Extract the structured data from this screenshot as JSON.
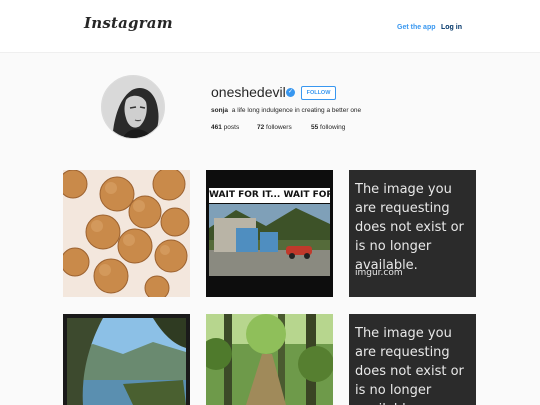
{
  "header": {
    "logo_text": "Instagram",
    "get_app_label": "Get the app",
    "login_label": "Log in"
  },
  "profile": {
    "username": "oneshedevil",
    "verified_icon": "verified-badge-icon",
    "follow_label": "FOLLOW",
    "bio_name": "sonja",
    "bio_text": "a life long indulgence in creating a better one",
    "stats": {
      "posts_count": "461",
      "posts_label": "posts",
      "followers_count": "72",
      "followers_label": "followers",
      "following_count": "55",
      "following_label": "following"
    }
  },
  "posts": {
    "meme_caption": "WAIT FOR IT... WAIT FOR IT...",
    "imgur_message": "The image you are requesting does not exist or is no longer available.",
    "imgur_domain": "imgur.com"
  },
  "colors": {
    "accent": "#3897f0",
    "login_link": "#003569",
    "background": "#fafafa"
  }
}
